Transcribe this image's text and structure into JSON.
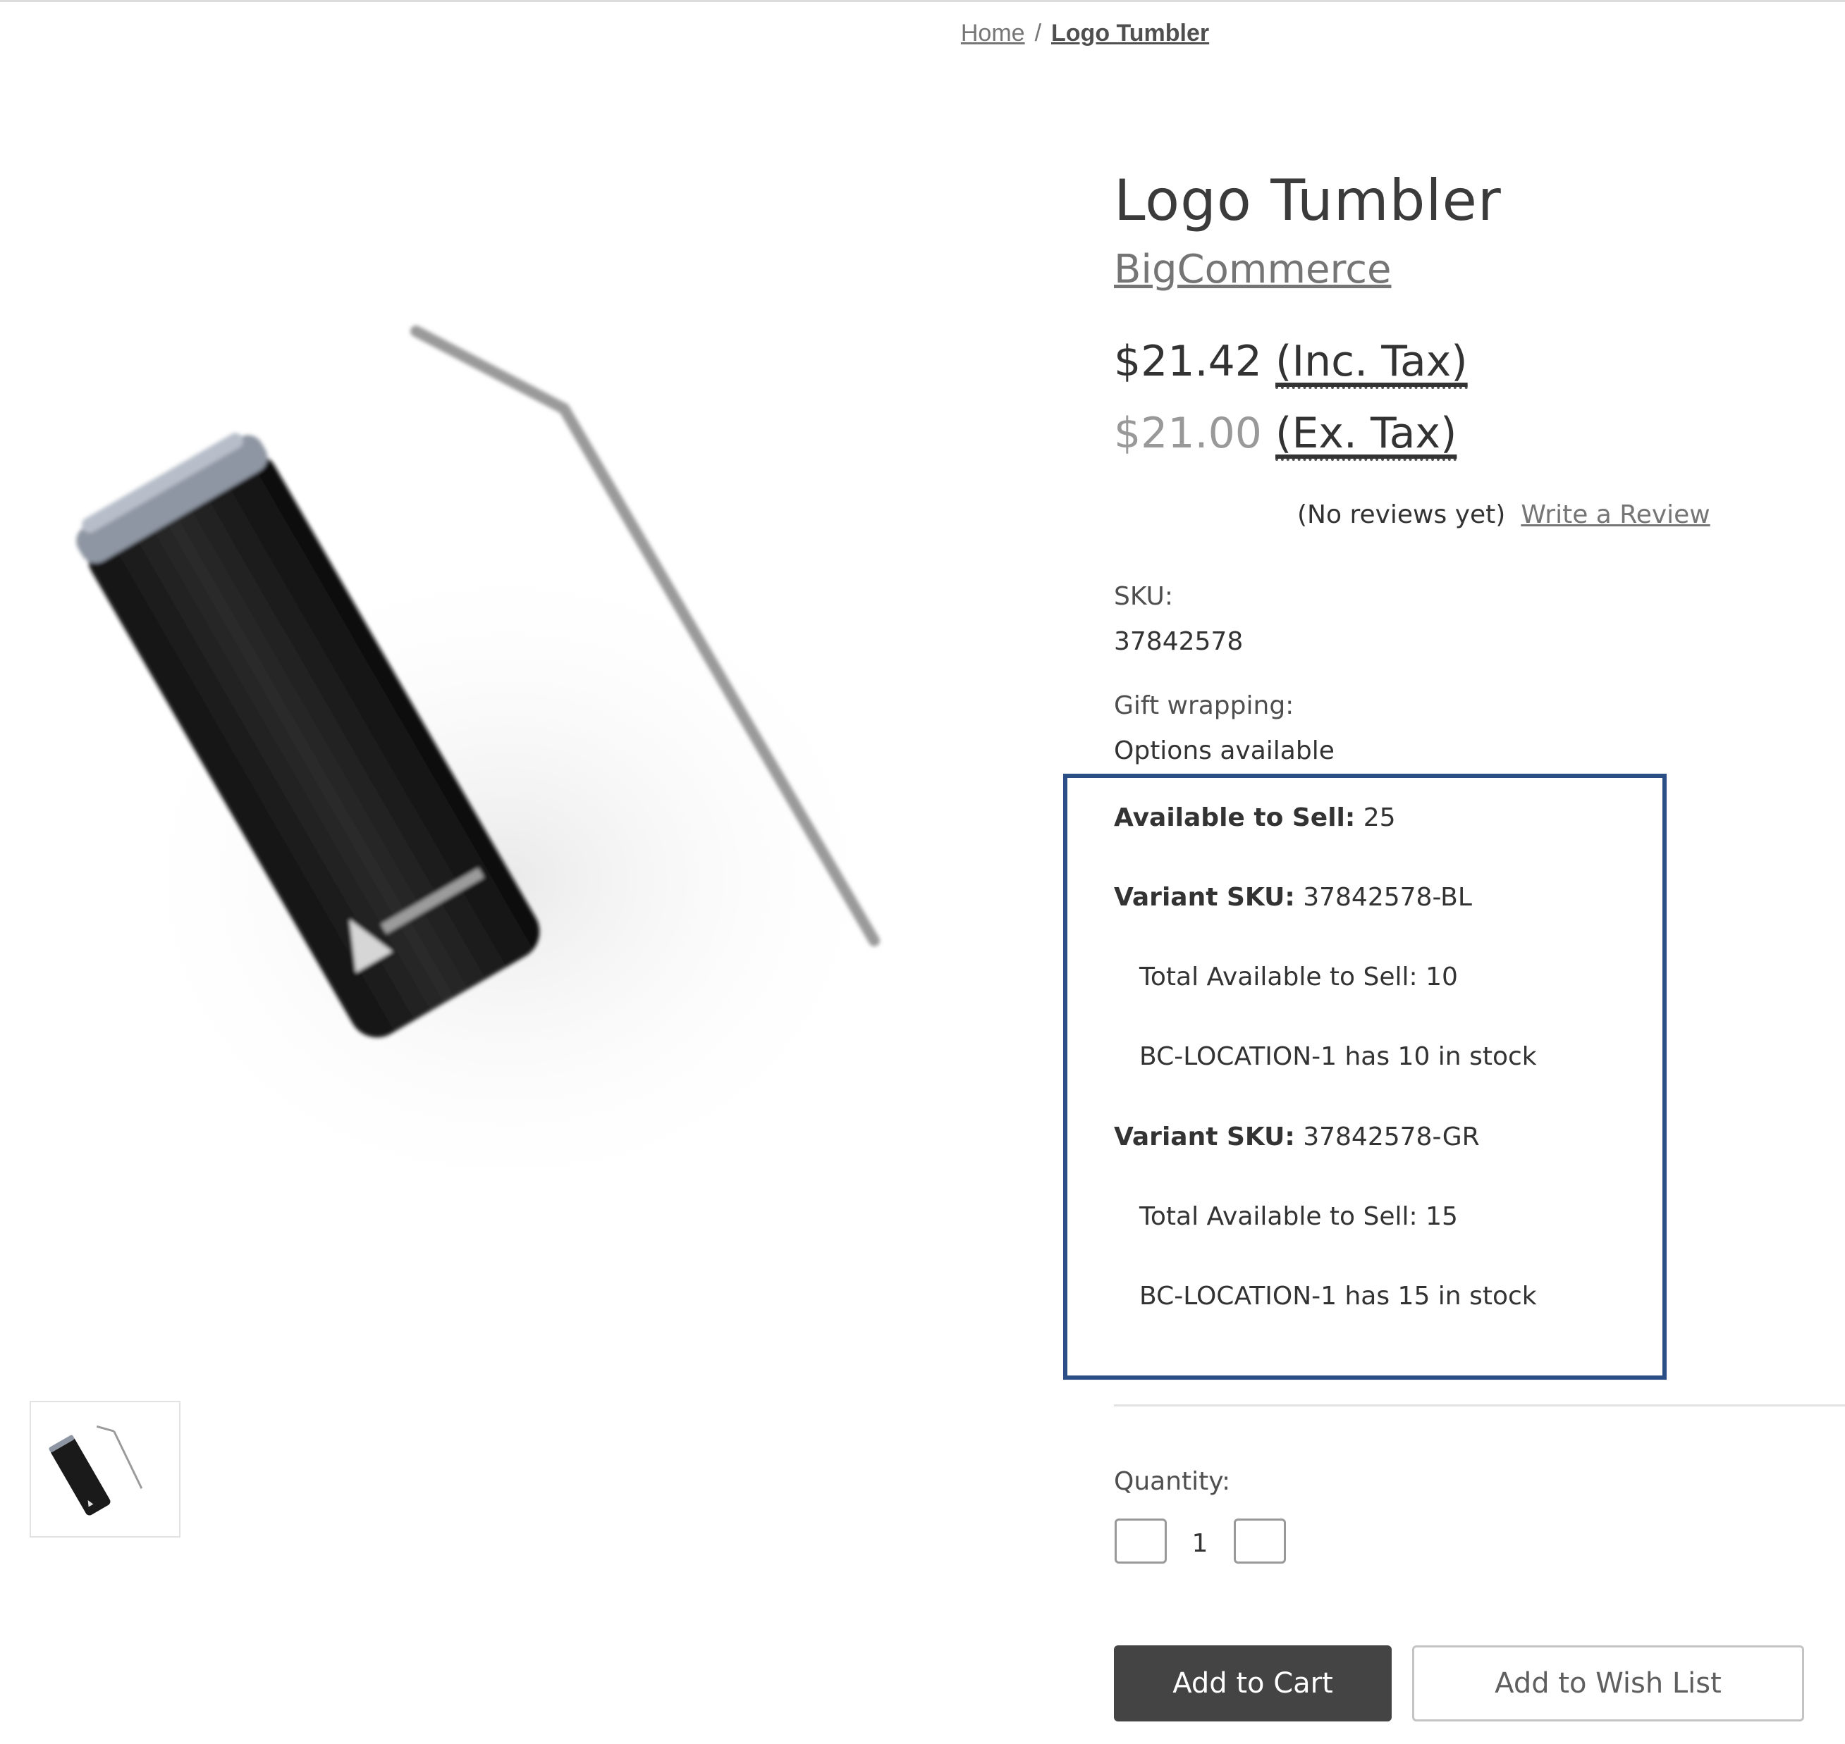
{
  "breadcrumb": {
    "home": "Home",
    "separator": "/",
    "current": "Logo Tumbler"
  },
  "product": {
    "title": "Logo Tumbler",
    "brand": "BigCommerce",
    "price_inc": "$21.42",
    "price_inc_label": "(Inc. Tax)",
    "price_ex": "$21.00",
    "price_ex_label": "(Ex. Tax)",
    "reviews_text": "(No reviews yet)",
    "write_review": "Write a Review",
    "sku_label": "SKU:",
    "sku_value": "37842578",
    "gift_label": "Gift wrapping:",
    "gift_value": "Options available"
  },
  "inventory": {
    "available_label": "Available to Sell:",
    "available_value": "25",
    "variants": [
      {
        "sku_label": "Variant SKU:",
        "sku": "37842578-BL",
        "total": "Total Available to Sell: 10",
        "location": "BC-LOCATION-1 has 10 in stock"
      },
      {
        "sku_label": "Variant SKU:",
        "sku": "37842578-GR",
        "total": "Total Available to Sell: 15",
        "location": "BC-LOCATION-1 has 15 in stock"
      }
    ],
    "border_color": "#2c4e86"
  },
  "quantity": {
    "label": "Quantity:",
    "value": "1"
  },
  "actions": {
    "add_to_cart": "Add to Cart",
    "add_to_wishlist": "Add to Wish List"
  },
  "icons": {
    "main_image": "tumbler-product-image",
    "thumbnail": "tumbler-thumbnail-image",
    "decrement": "minus-icon",
    "increment": "plus-icon"
  }
}
